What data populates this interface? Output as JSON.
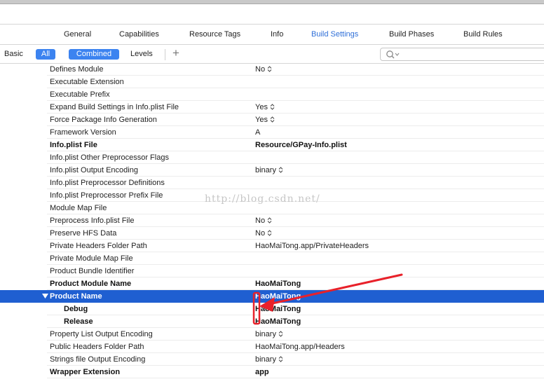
{
  "tabs": [
    {
      "label": "General",
      "active": false
    },
    {
      "label": "Capabilities",
      "active": false
    },
    {
      "label": "Resource Tags",
      "active": false
    },
    {
      "label": "Info",
      "active": false
    },
    {
      "label": "Build Settings",
      "active": true
    },
    {
      "label": "Build Phases",
      "active": false
    },
    {
      "label": "Build Rules",
      "active": false
    }
  ],
  "filter": {
    "basic_label": "Basic",
    "all_label": "All",
    "combined_label": "Combined",
    "levels_label": "Levels",
    "add_label": "+",
    "search_placeholder": ""
  },
  "settings": [
    {
      "name": "Defines Module",
      "value": "No",
      "stepper": true,
      "bold": false
    },
    {
      "name": "Executable Extension",
      "value": "",
      "stepper": false,
      "bold": false
    },
    {
      "name": "Executable Prefix",
      "value": "",
      "stepper": false,
      "bold": false
    },
    {
      "name": "Expand Build Settings in Info.plist File",
      "value": "Yes",
      "stepper": true,
      "bold": false
    },
    {
      "name": "Force Package Info Generation",
      "value": "Yes",
      "stepper": true,
      "bold": false
    },
    {
      "name": "Framework Version",
      "value": "A",
      "stepper": false,
      "bold": false
    },
    {
      "name": "Info.plist File",
      "value": "Resource/GPay-Info.plist",
      "stepper": false,
      "bold": true
    },
    {
      "name": "Info.plist Other Preprocessor Flags",
      "value": "",
      "stepper": false,
      "bold": false
    },
    {
      "name": "Info.plist Output Encoding",
      "value": "binary",
      "stepper": true,
      "bold": false
    },
    {
      "name": "Info.plist Preprocessor Definitions",
      "value": "",
      "stepper": false,
      "bold": false
    },
    {
      "name": "Info.plist Preprocessor Prefix File",
      "value": "",
      "stepper": false,
      "bold": false
    },
    {
      "name": "Module Map File",
      "value": "",
      "stepper": false,
      "bold": false
    },
    {
      "name": "Preprocess Info.plist File",
      "value": "No",
      "stepper": true,
      "bold": false
    },
    {
      "name": "Preserve HFS Data",
      "value": "No",
      "stepper": true,
      "bold": false
    },
    {
      "name": "Private Headers Folder Path",
      "value": "HaoMaiTong.app/PrivateHeaders",
      "stepper": false,
      "bold": false
    },
    {
      "name": "Private Module Map File",
      "value": "",
      "stepper": false,
      "bold": false
    },
    {
      "name": "Product Bundle Identifier",
      "value": "",
      "stepper": false,
      "bold": false
    },
    {
      "name": "Product Module Name",
      "value": "HaoMaiTong",
      "stepper": false,
      "bold": true
    },
    {
      "name": "Product Name",
      "value": "HaoMaiTong",
      "stepper": false,
      "bold": true,
      "selected": true,
      "expandable": true
    },
    {
      "name": "Debug",
      "value": "HaoMaiTong",
      "stepper": false,
      "bold": true,
      "sub": true
    },
    {
      "name": "Release",
      "value": "HaoMaiTong",
      "stepper": false,
      "bold": true,
      "sub": true
    },
    {
      "name": "Property List Output Encoding",
      "value": "binary",
      "stepper": true,
      "bold": false
    },
    {
      "name": "Public Headers Folder Path",
      "value": "HaoMaiTong.app/Headers",
      "stepper": false,
      "bold": false
    },
    {
      "name": "Strings file Output Encoding",
      "value": "binary",
      "stepper": true,
      "bold": false
    },
    {
      "name": "Wrapper Extension",
      "value": "app",
      "stepper": false,
      "bold": true
    }
  ],
  "watermark": "http://blog.csdn.net/",
  "colors": {
    "accent": "#2f6fd8",
    "pill": "#3c83f0",
    "selection": "#1f5fd1",
    "annotation": "#e8212a"
  }
}
